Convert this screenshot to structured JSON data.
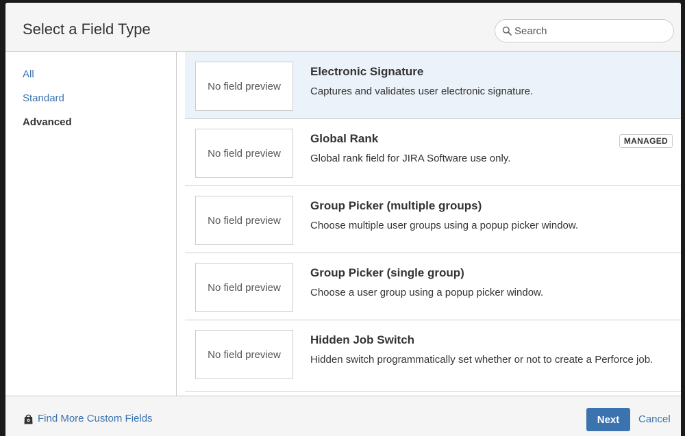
{
  "dialog": {
    "title": "Select a Field Type",
    "search": {
      "placeholder": "Search",
      "value": ""
    }
  },
  "sidebar": {
    "items": [
      {
        "label": "All",
        "active": false
      },
      {
        "label": "Standard",
        "active": false
      },
      {
        "label": "Advanced",
        "active": true
      }
    ]
  },
  "fields": [
    {
      "preview": "No field preview",
      "title": "Electronic Signature",
      "description": "Captures and validates user electronic signature.",
      "badge": "",
      "selected": true
    },
    {
      "preview": "No field preview",
      "title": "Global Rank",
      "description": "Global rank field for JIRA Software use only.",
      "badge": "MANAGED",
      "selected": false
    },
    {
      "preview": "No field preview",
      "title": "Group Picker (multiple groups)",
      "description": "Choose multiple user groups using a popup picker window.",
      "badge": "",
      "selected": false
    },
    {
      "preview": "No field preview",
      "title": "Group Picker (single group)",
      "description": "Choose a user group using a popup picker window.",
      "badge": "",
      "selected": false
    },
    {
      "preview": "No field preview",
      "title": "Hidden Job Switch",
      "description": "Hidden switch programmatically set whether or not to create a Perforce job.",
      "badge": "",
      "selected": false
    }
  ],
  "footer": {
    "find_more_label": "Find More Custom Fields",
    "find_more_icon": "marketplace-bag-icon",
    "next_label": "Next",
    "cancel_label": "Cancel"
  },
  "colors": {
    "link": "#3b73af",
    "primary_button": "#3b73af",
    "selected_row": "#ebf2f9"
  }
}
